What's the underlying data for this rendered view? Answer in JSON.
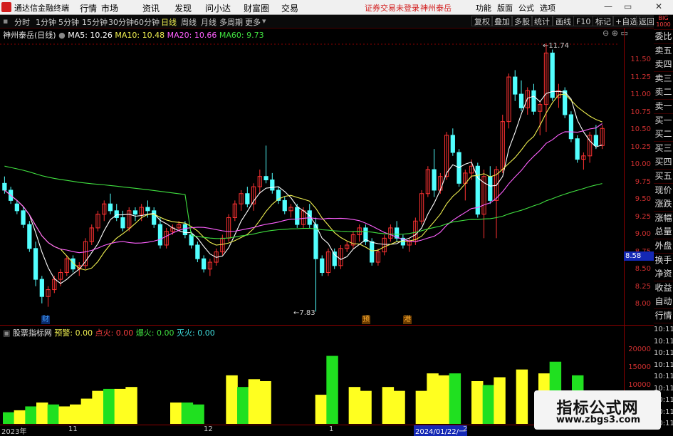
{
  "menubar": {
    "app_name": "通达信金融终端",
    "items": [
      "行情",
      "市场",
      "资讯",
      "发现",
      "问小达",
      "财富圈",
      "交易"
    ],
    "warning": "证券交易未登录",
    "stock_link": "神州泰岳",
    "right_items": [
      "功能",
      "版面",
      "公式",
      "选项"
    ],
    "window_controls": [
      "—",
      "▭",
      "✕"
    ]
  },
  "toolbar": {
    "periods": [
      "分时",
      "1分钟",
      "5分钟",
      "15分钟",
      "30分钟",
      "60分钟",
      "日线",
      "周线",
      "月线",
      "多周期",
      "更多"
    ],
    "active_period": "日线",
    "right_buttons": [
      "复权",
      "叠加",
      "多股",
      "统计",
      "画线",
      "F10",
      "标记",
      "+自选",
      "返回"
    ]
  },
  "chart_header": {
    "stock": "神州泰岳(日线)",
    "ma5_label": "MA5: 10.26",
    "ma10_label": "MA10: 10.48",
    "ma20_label": "MA20: 10.66",
    "ma60_label": "MA60: 9.73"
  },
  "colors": {
    "up": "#ff3232",
    "down": "#52ffff",
    "ma5": "#ffffff",
    "ma10": "#f0f050",
    "ma20": "#ff60ff",
    "ma60": "#40e040",
    "grid": "#8b0000"
  },
  "price_axis": [
    "11.50",
    "11.25",
    "11.00",
    "10.75",
    "10.50",
    "10.25",
    "10.00",
    "9.75",
    "9.50",
    "9.25",
    "9.00",
    "8.75",
    "8.50",
    "8.25",
    "8.00"
  ],
  "current_price": "8.58",
  "annotations": {
    "high": "11.74",
    "low": "7.83"
  },
  "event_markers": [
    "财",
    "预",
    "港"
  ],
  "indicator": {
    "name": "股票指标网",
    "labels": [
      "预警: 0.00",
      "点火: 0.00",
      "爆火: 0.00",
      "灭火: 0.00"
    ],
    "axis": [
      "20000",
      "15000",
      "10000",
      "5000"
    ]
  },
  "date_axis": [
    "2023年",
    "11",
    "12",
    "1",
    "2024/01/22/一",
    "2"
  ],
  "side_panel": {
    "top_labels": [
      "BIG",
      "1000"
    ],
    "buttons": [
      "委比",
      "卖五",
      "卖四",
      "卖三",
      "卖二",
      "卖一",
      "买一",
      "买二",
      "买三",
      "买四",
      "买五",
      "现价",
      "涨跌",
      "涨幅",
      "总量",
      "外盘",
      "换手",
      "净资",
      "收益",
      "自动",
      "行情"
    ],
    "times": [
      "10:11",
      "10:11",
      "10:11",
      "10:11",
      "10:11",
      "10:11",
      "10:11",
      "10:11",
      "10:11"
    ]
  },
  "watermark": {
    "title": "指标公式网",
    "url": "www.zbgs3.com"
  },
  "chart_data": {
    "type": "candlestick",
    "y_range": [
      7.7,
      11.85
    ],
    "candles": [
      [
        9.7,
        9.8,
        9.55,
        9.6
      ],
      [
        9.6,
        9.65,
        9.4,
        9.45
      ],
      [
        9.4,
        9.45,
        9.25,
        9.3
      ],
      [
        9.3,
        9.35,
        9.05,
        9.1
      ],
      [
        9.1,
        9.15,
        8.7,
        8.75
      ],
      [
        8.75,
        8.85,
        8.2,
        8.3
      ],
      [
        8.3,
        8.35,
        7.95,
        8.05
      ],
      [
        8.05,
        8.2,
        7.9,
        8.15
      ],
      [
        8.15,
        8.35,
        8.1,
        8.3
      ],
      [
        8.3,
        8.45,
        8.2,
        8.4
      ],
      [
        8.4,
        8.65,
        8.35,
        8.6
      ],
      [
        8.6,
        8.65,
        8.4,
        8.45
      ],
      [
        8.45,
        8.55,
        8.35,
        8.5
      ],
      [
        8.5,
        8.9,
        8.45,
        8.85
      ],
      [
        8.85,
        9.1,
        8.8,
        9.05
      ],
      [
        9.05,
        9.3,
        9.0,
        9.25
      ],
      [
        9.25,
        9.45,
        9.15,
        9.4
      ],
      [
        9.4,
        9.55,
        9.25,
        9.3
      ],
      [
        9.3,
        9.4,
        9.15,
        9.2
      ],
      [
        9.2,
        9.3,
        9.0,
        9.05
      ],
      [
        9.05,
        9.35,
        9.0,
        9.3
      ],
      [
        9.3,
        9.35,
        9.15,
        9.25
      ],
      [
        9.25,
        9.4,
        9.15,
        9.35
      ],
      [
        9.35,
        9.45,
        9.2,
        9.3
      ],
      [
        9.3,
        9.35,
        9.05,
        9.1
      ],
      [
        9.1,
        9.2,
        8.75,
        8.8
      ],
      [
        8.8,
        9.05,
        8.75,
        9.0
      ],
      [
        9.0,
        9.1,
        8.95,
        9.05
      ],
      [
        9.05,
        9.15,
        9.0,
        9.1
      ],
      [
        9.1,
        9.15,
        8.9,
        8.95
      ],
      [
        8.95,
        9.0,
        8.75,
        8.8
      ],
      [
        8.8,
        8.85,
        8.55,
        8.6
      ],
      [
        8.6,
        8.65,
        8.4,
        8.45
      ],
      [
        8.45,
        8.6,
        8.35,
        8.55
      ],
      [
        8.55,
        8.75,
        8.5,
        8.7
      ],
      [
        8.7,
        8.95,
        8.65,
        8.9
      ],
      [
        8.9,
        9.25,
        8.85,
        9.2
      ],
      [
        9.2,
        9.45,
        9.15,
        9.4
      ],
      [
        9.4,
        9.6,
        9.3,
        9.55
      ],
      [
        9.55,
        9.65,
        9.35,
        9.4
      ],
      [
        9.4,
        9.7,
        9.3,
        9.65
      ],
      [
        9.65,
        9.9,
        9.55,
        9.8
      ],
      [
        9.8,
        10.25,
        9.7,
        9.75
      ],
      [
        9.75,
        9.85,
        9.55,
        9.6
      ],
      [
        9.6,
        9.65,
        9.4,
        9.45
      ],
      [
        9.45,
        9.5,
        9.25,
        9.3
      ],
      [
        9.3,
        9.4,
        9.2,
        9.35
      ],
      [
        9.35,
        9.4,
        9.05,
        9.1
      ],
      [
        9.1,
        9.35,
        9.05,
        9.3
      ],
      [
        9.3,
        9.4,
        9.05,
        9.1
      ],
      [
        9.1,
        9.2,
        7.83,
        8.6
      ],
      [
        8.6,
        8.65,
        8.35,
        8.4
      ],
      [
        8.4,
        8.75,
        8.35,
        8.7
      ],
      [
        8.7,
        8.75,
        8.45,
        8.5
      ],
      [
        8.5,
        8.8,
        8.45,
        8.75
      ],
      [
        8.75,
        8.85,
        8.7,
        8.8
      ],
      [
        8.8,
        9.0,
        8.75,
        8.95
      ],
      [
        8.95,
        9.1,
        8.85,
        9.05
      ],
      [
        9.05,
        9.1,
        8.8,
        8.85
      ],
      [
        8.85,
        8.9,
        8.5,
        8.55
      ],
      [
        8.55,
        8.75,
        8.5,
        8.7
      ],
      [
        8.7,
        8.95,
        8.65,
        8.9
      ],
      [
        8.9,
        9.1,
        8.85,
        9.05
      ],
      [
        9.05,
        9.15,
        8.85,
        8.9
      ],
      [
        8.9,
        8.95,
        8.75,
        8.8
      ],
      [
        8.8,
        8.9,
        8.7,
        8.85
      ],
      [
        8.85,
        9.2,
        8.8,
        9.15
      ],
      [
        9.15,
        9.6,
        9.1,
        9.55
      ],
      [
        9.55,
        9.95,
        9.5,
        9.9
      ],
      [
        9.9,
        10.2,
        9.5,
        9.6
      ],
      [
        9.6,
        9.85,
        9.55,
        9.8
      ],
      [
        9.8,
        10.45,
        9.75,
        10.4
      ],
      [
        10.4,
        10.5,
        10.1,
        10.15
      ],
      [
        10.15,
        10.2,
        9.65,
        9.7
      ],
      [
        9.7,
        9.9,
        9.45,
        9.85
      ],
      [
        9.85,
        10.05,
        9.75,
        9.95
      ],
      [
        9.95,
        10.0,
        9.2,
        9.25
      ],
      [
        9.25,
        9.9,
        8.9,
        9.8
      ],
      [
        9.8,
        9.95,
        9.4,
        9.45
      ],
      [
        9.45,
        9.95,
        8.9,
        9.9
      ],
      [
        9.9,
        10.7,
        9.85,
        10.6
      ],
      [
        10.6,
        11.3,
        10.5,
        11.25
      ],
      [
        11.25,
        11.35,
        10.9,
        11.0
      ],
      [
        11.0,
        11.2,
        10.75,
        10.8
      ],
      [
        10.8,
        11.1,
        10.7,
        11.05
      ],
      [
        11.05,
        11.15,
        10.7,
        10.75
      ],
      [
        10.75,
        10.9,
        10.4,
        10.85
      ],
      [
        10.85,
        11.74,
        10.45,
        11.6
      ],
      [
        11.6,
        11.65,
        10.9,
        10.95
      ],
      [
        10.95,
        11.15,
        10.8,
        11.05
      ],
      [
        11.05,
        11.1,
        10.65,
        10.7
      ],
      [
        10.7,
        10.75,
        10.3,
        10.35
      ],
      [
        10.35,
        10.4,
        10.0,
        10.05
      ],
      [
        10.05,
        10.15,
        9.9,
        10.1
      ],
      [
        10.1,
        10.45,
        10.0,
        10.4
      ],
      [
        10.4,
        10.55,
        10.2,
        10.25
      ],
      [
        10.25,
        10.55,
        10.2,
        10.5
      ]
    ],
    "volume": [
      [
        0,
        3000
      ],
      [
        1,
        3500
      ],
      [
        0,
        4500
      ],
      [
        1,
        5500
      ],
      [
        0,
        5000
      ],
      [
        1,
        4500
      ],
      [
        1,
        5000
      ],
      [
        1,
        6500
      ],
      [
        1,
        8500
      ],
      [
        0,
        9000
      ],
      [
        1,
        9000
      ],
      [
        1,
        9500
      ],
      [
        1,
        0
      ],
      [
        1,
        0
      ],
      [
        1,
        0
      ],
      [
        1,
        5500
      ],
      [
        0,
        5500
      ],
      [
        0,
        5000
      ],
      [
        1,
        0
      ],
      [
        1,
        0
      ],
      [
        1,
        12500
      ],
      [
        0,
        9500
      ],
      [
        1,
        11500
      ],
      [
        1,
        11000
      ],
      [
        1,
        0
      ],
      [
        1,
        0
      ],
      [
        1,
        0
      ],
      [
        1,
        0
      ],
      [
        1,
        7500
      ],
      [
        0,
        17500
      ],
      [
        1,
        0
      ],
      [
        1,
        9500
      ],
      [
        1,
        8500
      ],
      [
        1,
        0
      ],
      [
        1,
        9500
      ],
      [
        1,
        8500
      ],
      [
        1,
        0
      ],
      [
        1,
        8500
      ],
      [
        1,
        13000
      ],
      [
        1,
        12500
      ],
      [
        0,
        13000
      ],
      [
        1,
        0
      ],
      [
        1,
        11000
      ],
      [
        0,
        10000
      ],
      [
        1,
        12000
      ],
      [
        1,
        0
      ],
      [
        1,
        14000
      ],
      [
        1,
        0
      ],
      [
        1,
        13000
      ],
      [
        0,
        16000
      ],
      [
        1,
        0
      ],
      [
        0,
        12500
      ],
      [
        1,
        0
      ],
      [
        0,
        8500
      ]
    ]
  }
}
